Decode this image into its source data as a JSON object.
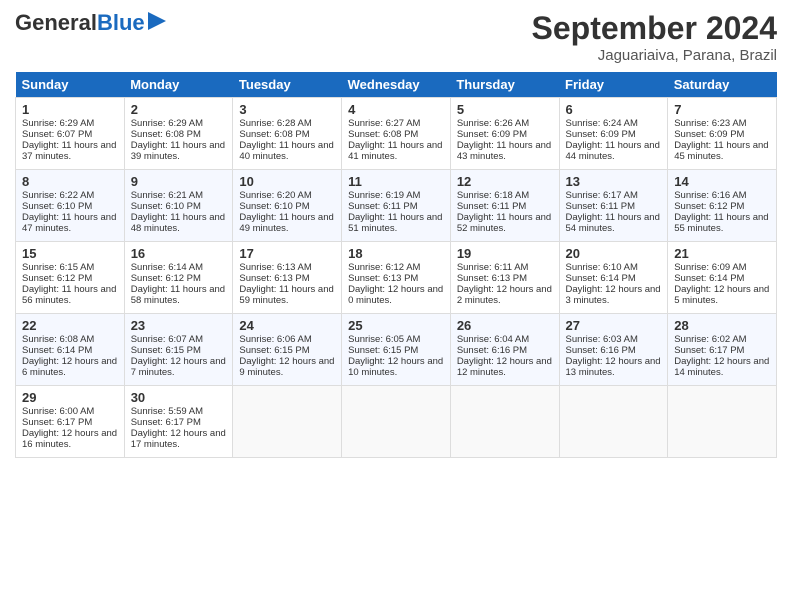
{
  "header": {
    "logo_general": "General",
    "logo_blue": "Blue",
    "month": "September 2024",
    "location": "Jaguariaiva, Parana, Brazil"
  },
  "days_of_week": [
    "Sunday",
    "Monday",
    "Tuesday",
    "Wednesday",
    "Thursday",
    "Friday",
    "Saturday"
  ],
  "weeks": [
    [
      {
        "day": "1",
        "sunrise": "6:29 AM",
        "sunset": "6:07 PM",
        "daylight": "11 hours and 37 minutes."
      },
      {
        "day": "2",
        "sunrise": "6:29 AM",
        "sunset": "6:08 PM",
        "daylight": "11 hours and 39 minutes."
      },
      {
        "day": "3",
        "sunrise": "6:28 AM",
        "sunset": "6:08 PM",
        "daylight": "11 hours and 40 minutes."
      },
      {
        "day": "4",
        "sunrise": "6:27 AM",
        "sunset": "6:08 PM",
        "daylight": "11 hours and 41 minutes."
      },
      {
        "day": "5",
        "sunrise": "6:26 AM",
        "sunset": "6:09 PM",
        "daylight": "11 hours and 43 minutes."
      },
      {
        "day": "6",
        "sunrise": "6:24 AM",
        "sunset": "6:09 PM",
        "daylight": "11 hours and 44 minutes."
      },
      {
        "day": "7",
        "sunrise": "6:23 AM",
        "sunset": "6:09 PM",
        "daylight": "11 hours and 45 minutes."
      }
    ],
    [
      {
        "day": "8",
        "sunrise": "6:22 AM",
        "sunset": "6:10 PM",
        "daylight": "11 hours and 47 minutes."
      },
      {
        "day": "9",
        "sunrise": "6:21 AM",
        "sunset": "6:10 PM",
        "daylight": "11 hours and 48 minutes."
      },
      {
        "day": "10",
        "sunrise": "6:20 AM",
        "sunset": "6:10 PM",
        "daylight": "11 hours and 49 minutes."
      },
      {
        "day": "11",
        "sunrise": "6:19 AM",
        "sunset": "6:11 PM",
        "daylight": "11 hours and 51 minutes."
      },
      {
        "day": "12",
        "sunrise": "6:18 AM",
        "sunset": "6:11 PM",
        "daylight": "11 hours and 52 minutes."
      },
      {
        "day": "13",
        "sunrise": "6:17 AM",
        "sunset": "6:11 PM",
        "daylight": "11 hours and 54 minutes."
      },
      {
        "day": "14",
        "sunrise": "6:16 AM",
        "sunset": "6:12 PM",
        "daylight": "11 hours and 55 minutes."
      }
    ],
    [
      {
        "day": "15",
        "sunrise": "6:15 AM",
        "sunset": "6:12 PM",
        "daylight": "11 hours and 56 minutes."
      },
      {
        "day": "16",
        "sunrise": "6:14 AM",
        "sunset": "6:12 PM",
        "daylight": "11 hours and 58 minutes."
      },
      {
        "day": "17",
        "sunrise": "6:13 AM",
        "sunset": "6:13 PM",
        "daylight": "11 hours and 59 minutes."
      },
      {
        "day": "18",
        "sunrise": "6:12 AM",
        "sunset": "6:13 PM",
        "daylight": "12 hours and 0 minutes."
      },
      {
        "day": "19",
        "sunrise": "6:11 AM",
        "sunset": "6:13 PM",
        "daylight": "12 hours and 2 minutes."
      },
      {
        "day": "20",
        "sunrise": "6:10 AM",
        "sunset": "6:14 PM",
        "daylight": "12 hours and 3 minutes."
      },
      {
        "day": "21",
        "sunrise": "6:09 AM",
        "sunset": "6:14 PM",
        "daylight": "12 hours and 5 minutes."
      }
    ],
    [
      {
        "day": "22",
        "sunrise": "6:08 AM",
        "sunset": "6:14 PM",
        "daylight": "12 hours and 6 minutes."
      },
      {
        "day": "23",
        "sunrise": "6:07 AM",
        "sunset": "6:15 PM",
        "daylight": "12 hours and 7 minutes."
      },
      {
        "day": "24",
        "sunrise": "6:06 AM",
        "sunset": "6:15 PM",
        "daylight": "12 hours and 9 minutes."
      },
      {
        "day": "25",
        "sunrise": "6:05 AM",
        "sunset": "6:15 PM",
        "daylight": "12 hours and 10 minutes."
      },
      {
        "day": "26",
        "sunrise": "6:04 AM",
        "sunset": "6:16 PM",
        "daylight": "12 hours and 12 minutes."
      },
      {
        "day": "27",
        "sunrise": "6:03 AM",
        "sunset": "6:16 PM",
        "daylight": "12 hours and 13 minutes."
      },
      {
        "day": "28",
        "sunrise": "6:02 AM",
        "sunset": "6:17 PM",
        "daylight": "12 hours and 14 minutes."
      }
    ],
    [
      {
        "day": "29",
        "sunrise": "6:00 AM",
        "sunset": "6:17 PM",
        "daylight": "12 hours and 16 minutes."
      },
      {
        "day": "30",
        "sunrise": "5:59 AM",
        "sunset": "6:17 PM",
        "daylight": "12 hours and 17 minutes."
      },
      null,
      null,
      null,
      null,
      null
    ]
  ],
  "labels": {
    "sunrise": "Sunrise:",
    "sunset": "Sunset:",
    "daylight": "Daylight:"
  }
}
